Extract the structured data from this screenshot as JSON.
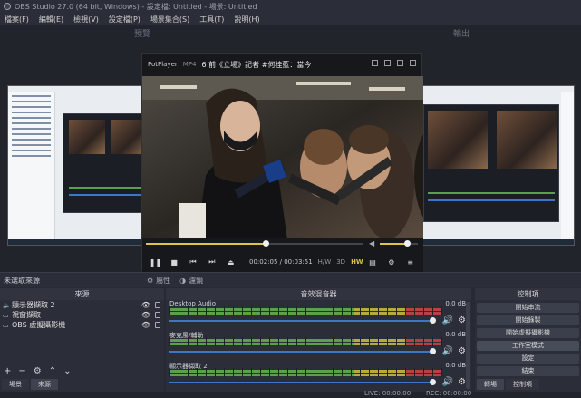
{
  "window": {
    "title": "OBS Studio 27.0 (64 bit, Windows) - 設定檔: Untitled - 場景: Untitled"
  },
  "menu": [
    "檔案(F)",
    "編輯(E)",
    "檢視(V)",
    "設定檔(P)",
    "場景集合(S)",
    "工具(T)",
    "說明(H)"
  ],
  "preview": {
    "left_label": "預覽",
    "right_label": "輸出"
  },
  "potplayer": {
    "app_name": "PotPlayer",
    "format": "MP4",
    "video_title": "6 前《立場》記者 #何桂藍：當今",
    "time": "00:02:05 / 00:03:51",
    "tags": [
      "H/W",
      "3D",
      "HW"
    ],
    "seek_fraction": 0.55,
    "volume_fraction": 0.72
  },
  "source_toolbar": {
    "no_source": "未選取來源",
    "properties": "屬性",
    "filters": "濾鏡"
  },
  "docks": {
    "sources_title": "來源",
    "mixer_title": "音效混音器",
    "controls_title": "控制項"
  },
  "sources": [
    {
      "icon": "speaker-icon",
      "name": "顯示器擷取 2"
    },
    {
      "icon": "monitor-icon",
      "name": "視窗擷取"
    },
    {
      "icon": "monitor-icon",
      "name": "OBS 虛擬攝影機"
    }
  ],
  "mixer": [
    {
      "name": "Desktop Audio",
      "db": "0.0 dB"
    },
    {
      "name": "麥克風/輔助",
      "db": "0.0 dB"
    },
    {
      "name": "顯示器擷取 2",
      "db": "0.0 dB"
    }
  ],
  "controls": [
    "開始串流",
    "開始錄製",
    "開始虛擬攝影機",
    "工作室模式",
    "設定",
    "結束"
  ],
  "tabs_left": [
    "場景",
    "來源"
  ],
  "tabs_right": [
    "轉場",
    "控制項"
  ],
  "status": {
    "live": "LIVE: 00:00:00",
    "rec": "REC: 00:00:00"
  },
  "colors": {
    "accent": "#e0c34a",
    "meter_green": "#5ba04d",
    "fader_blue": "#3d76c7"
  }
}
